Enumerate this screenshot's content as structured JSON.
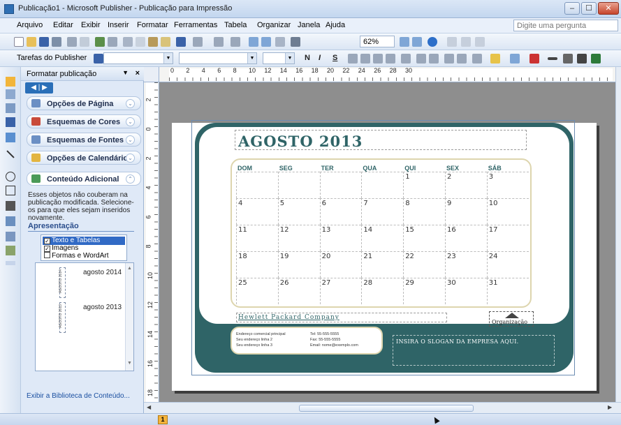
{
  "window": {
    "title": "Publicação1 - Microsoft Publisher - Publicação para Impressão",
    "controls": {
      "minimize": "‒",
      "maximize": "☐",
      "close": "✕"
    }
  },
  "menu": {
    "items": [
      "Arquivo",
      "Editar",
      "Exibir",
      "Inserir",
      "Formatar",
      "Ferramentas",
      "Tabela",
      "Organizar",
      "Janela",
      "Ajuda"
    ],
    "ask_placeholder": "Digite uma pergunta"
  },
  "toolbar": {
    "zoom": "62%",
    "tasks_label": "Tarefas do Publisher",
    "format_glyphs": [
      "N",
      "I",
      "S"
    ]
  },
  "taskpane": {
    "title": "Formatar publicação",
    "sections": [
      {
        "label": "Opções de Página",
        "icon_color": "#6b8fc4"
      },
      {
        "label": "Esquemas de Cores",
        "icon_color": "#c94b3a"
      },
      {
        "label": "Esquemas de Fontes",
        "icon_color": "#6b8fc4"
      },
      {
        "label": "Opções de Calendário",
        "icon_color": "#e3b541"
      },
      {
        "label": "Conteúdo Adicional",
        "icon_color": "#4b9a58"
      }
    ],
    "info_text": "Esses objetos não couberam na publicação modificada. Selecione-os para que eles sejam inseridos novamente.",
    "display_heading": "Apresentação",
    "checkboxes": [
      {
        "label": "Texto e Tabelas",
        "checked": true,
        "selected": true
      },
      {
        "label": "Imagens",
        "checked": true,
        "selected": false
      },
      {
        "label": "Formas e WordArt",
        "checked": false,
        "selected": false
      }
    ],
    "gallery": [
      {
        "label": "agosto 2014",
        "thumb": "AGOSTO 2014"
      },
      {
        "label": "agosto 2013",
        "thumb": "AGOSTO 2013"
      }
    ],
    "footer_link": "Exibir a Biblioteca de Conteúdo..."
  },
  "rulers": {
    "horizontal": [
      "0",
      "2",
      "4",
      "6",
      "8",
      "10",
      "12",
      "14",
      "16",
      "18",
      "20",
      "22",
      "24",
      "26",
      "28",
      "30"
    ],
    "vertical": [
      "2",
      "0",
      "2",
      "4",
      "6",
      "8",
      "10",
      "12",
      "14",
      "16",
      "18",
      "20"
    ]
  },
  "calendar": {
    "month_title": "AGOSTO 2013",
    "weekdays": [
      "DOM",
      "SEG",
      "TER",
      "QUA",
      "QUI",
      "SEX",
      "SÁB"
    ],
    "weeks": [
      [
        "",
        "",
        "",
        "",
        "1",
        "2",
        "3"
      ],
      [
        "4",
        "5",
        "6",
        "7",
        "8",
        "9",
        "10"
      ],
      [
        "11",
        "12",
        "13",
        "14",
        "15",
        "16",
        "17"
      ],
      [
        "18",
        "19",
        "20",
        "21",
        "22",
        "23",
        "24"
      ],
      [
        "25",
        "26",
        "27",
        "28",
        "29",
        "30",
        "31"
      ]
    ],
    "company": "Hewlett Packard Company",
    "organization": "Organização",
    "address_lines": [
      "Endereço comercial principal",
      "Seu endereço linha 2",
      "Seu endereço linha 3"
    ],
    "contact_lines": [
      "Tel: 55-555-5555",
      "Fax: 55-555-5555",
      "Email: nome@exemplo.com"
    ],
    "slogan": "INSIRA O SLOGAN DA EMPRESA AQUI.",
    "colors": {
      "frame": "#2f6467",
      "accent": "#ddd5ae"
    }
  },
  "status": {
    "page_number": "1"
  }
}
